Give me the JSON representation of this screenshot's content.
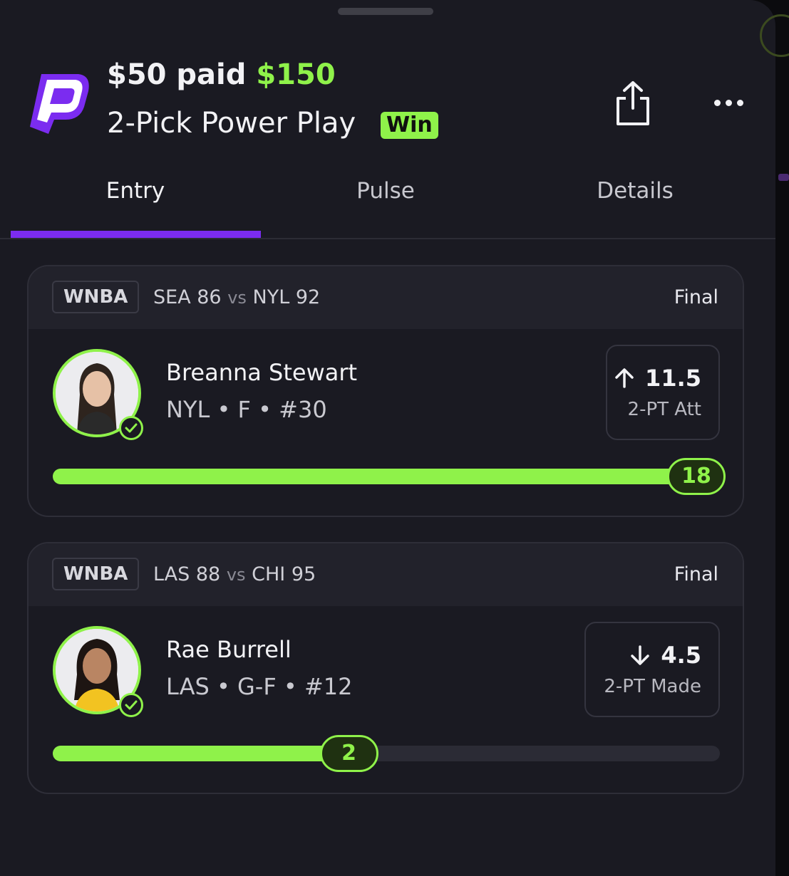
{
  "header": {
    "paid_label": "$50 paid",
    "payout": "$150",
    "play_type": "2-Pick Power Play",
    "result_badge": "Win"
  },
  "tabs": [
    {
      "label": "Entry",
      "active": true
    },
    {
      "label": "Pulse",
      "active": false
    },
    {
      "label": "Details",
      "active": false
    }
  ],
  "picks": [
    {
      "league": "WNBA",
      "away": "SEA 86",
      "vs": "vs",
      "home": "NYL 92",
      "status": "Final",
      "player_name": "Breanna Stewart",
      "player_info": "NYL • F • #30",
      "direction": "up",
      "line": "11.5",
      "stat": "2-PT Att",
      "actual": "18",
      "progress_fraction": 1.0
    },
    {
      "league": "WNBA",
      "away": "LAS 88",
      "vs": "vs",
      "home": "CHI 95",
      "status": "Final",
      "player_name": "Rae Burrell",
      "player_info": "LAS • G-F • #12",
      "direction": "down",
      "line": "4.5",
      "stat": "2-PT Made",
      "actual": "2",
      "progress_fraction": 0.444
    }
  ],
  "colors": {
    "accent_green": "#8ff24a",
    "accent_purple": "#7b2cf0",
    "background": "#1a1a22"
  }
}
